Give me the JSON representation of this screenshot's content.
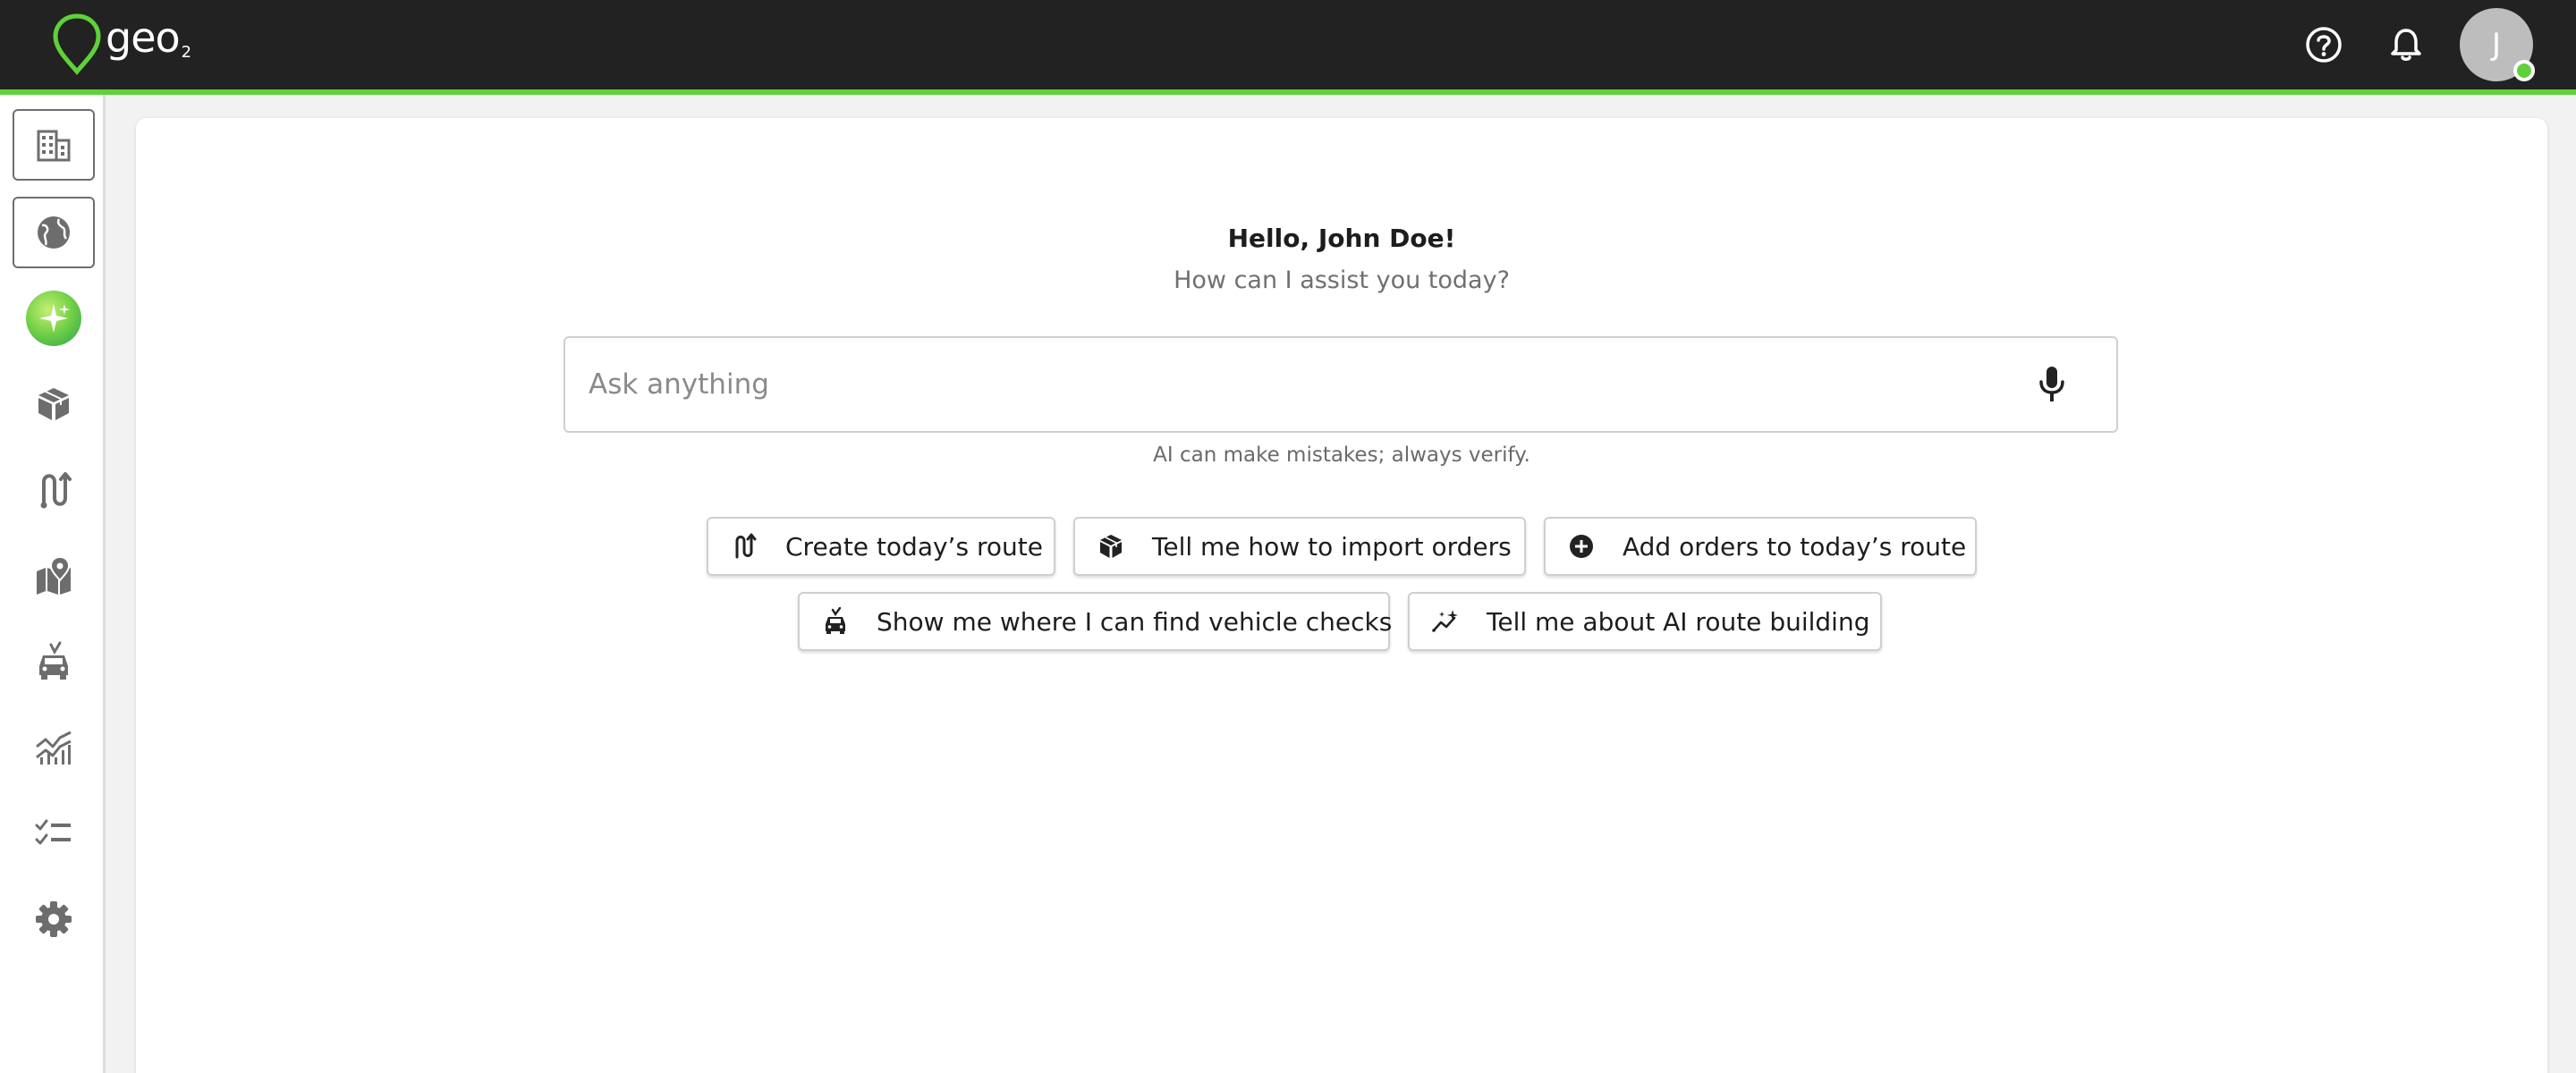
{
  "brand": {
    "name": "geo",
    "sub": "2",
    "accent": "#5fd13a"
  },
  "topbar": {
    "avatar_initial": "J",
    "status_color": "#5fd13a"
  },
  "sidebar": {
    "items": [
      {
        "icon": "building-icon"
      },
      {
        "icon": "globe-icon"
      },
      {
        "icon": "ai-sparkle-icon"
      },
      {
        "icon": "package-icon"
      },
      {
        "icon": "route-icon"
      },
      {
        "icon": "map-pin-icon"
      },
      {
        "icon": "vehicle-icon"
      },
      {
        "icon": "analytics-icon"
      },
      {
        "icon": "checklist-icon"
      },
      {
        "icon": "gear-icon"
      }
    ]
  },
  "assistant": {
    "greeting": "Hello, John Doe!",
    "subtitle": "How can I assist you today?",
    "input_placeholder": "Ask anything",
    "input_value": "",
    "disclaimer": "AI can make mistakes; always verify."
  },
  "suggestions": [
    {
      "label": "Create today’s route",
      "icon": "route-icon"
    },
    {
      "label": "Tell me how to import orders",
      "icon": "package-icon"
    },
    {
      "label": "Add orders to today’s route",
      "icon": "add-circle-icon"
    },
    {
      "label": "Show me where I can find vehicle checks",
      "icon": "vehicle-check-icon"
    },
    {
      "label": "Tell me about AI route building",
      "icon": "ai-route-icon"
    }
  ]
}
